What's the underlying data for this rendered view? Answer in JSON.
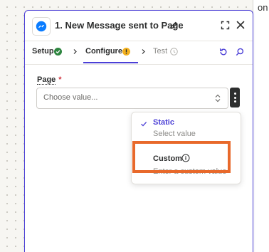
{
  "background": {
    "edge_text": "on"
  },
  "step_panel": {
    "title": "1. New Message sent to Page",
    "app_icon": "messenger-icon",
    "icons": {
      "edit": "pencil-icon",
      "expand": "expand-icon",
      "close": "close-icon"
    }
  },
  "tabs": [
    {
      "label": "Setup",
      "status": "complete",
      "status_icon": "check-circle-icon"
    },
    {
      "label": "Configure",
      "status": "warning",
      "status_icon": "warning-icon",
      "active": true
    },
    {
      "label": "Test",
      "status": "pending",
      "status_icon": "clock-icon"
    }
  ],
  "tab_actions": {
    "refresh": "refresh-icon",
    "search": "search-icon"
  },
  "field": {
    "label": "Page",
    "required_mark": "*",
    "placeholder": "Choose value...",
    "menu": "kebab-menu-icon"
  },
  "dropdown": {
    "options": [
      {
        "title": "Static",
        "subtitle": "Select value",
        "selected": true
      },
      {
        "title": "Custom",
        "subtitle": "Enter a custom value",
        "selected": false
      }
    ]
  },
  "colors": {
    "accent": "#4b3fd6",
    "success": "#2e8540",
    "warning": "#f2b01e",
    "highlight": "#e8692b",
    "messenger": "#0a7cff"
  }
}
